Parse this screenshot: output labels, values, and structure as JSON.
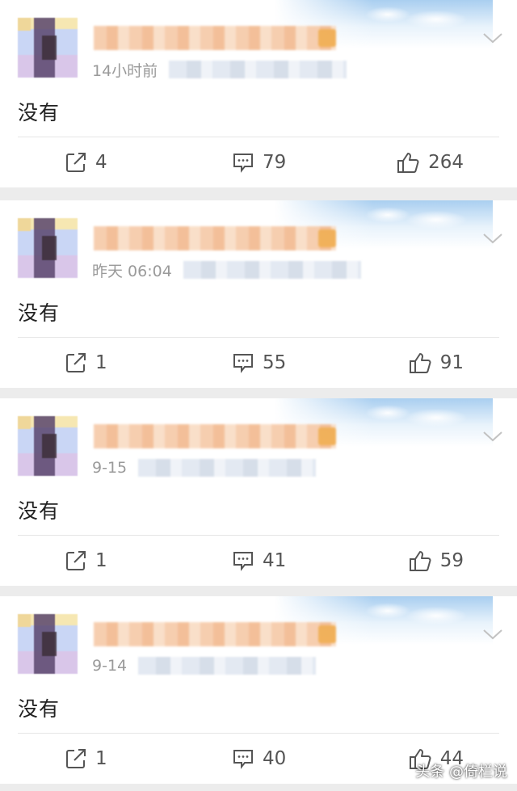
{
  "posts": [
    {
      "time": "14小时前",
      "content": "没有",
      "reposts": "4",
      "comments": "79",
      "likes": "264"
    },
    {
      "time": "昨天 06:04",
      "content": "没有",
      "reposts": "1",
      "comments": "55",
      "likes": "91"
    },
    {
      "time": "9-15",
      "content": "没有",
      "reposts": "1",
      "comments": "41",
      "likes": "59"
    },
    {
      "time": "9-14",
      "content": "没有",
      "reposts": "1",
      "comments": "40",
      "likes": "44"
    }
  ],
  "watermark": "头条 @倚栏说",
  "colors": {
    "card_bg": "#ffffff",
    "page_bg": "#ececec",
    "text": "#222222",
    "meta": "#9a9a9a"
  },
  "icons": {
    "repost": "repost-icon",
    "comment": "comment-icon",
    "like": "thumbs-up-icon",
    "menu": "chevron-down-icon"
  }
}
